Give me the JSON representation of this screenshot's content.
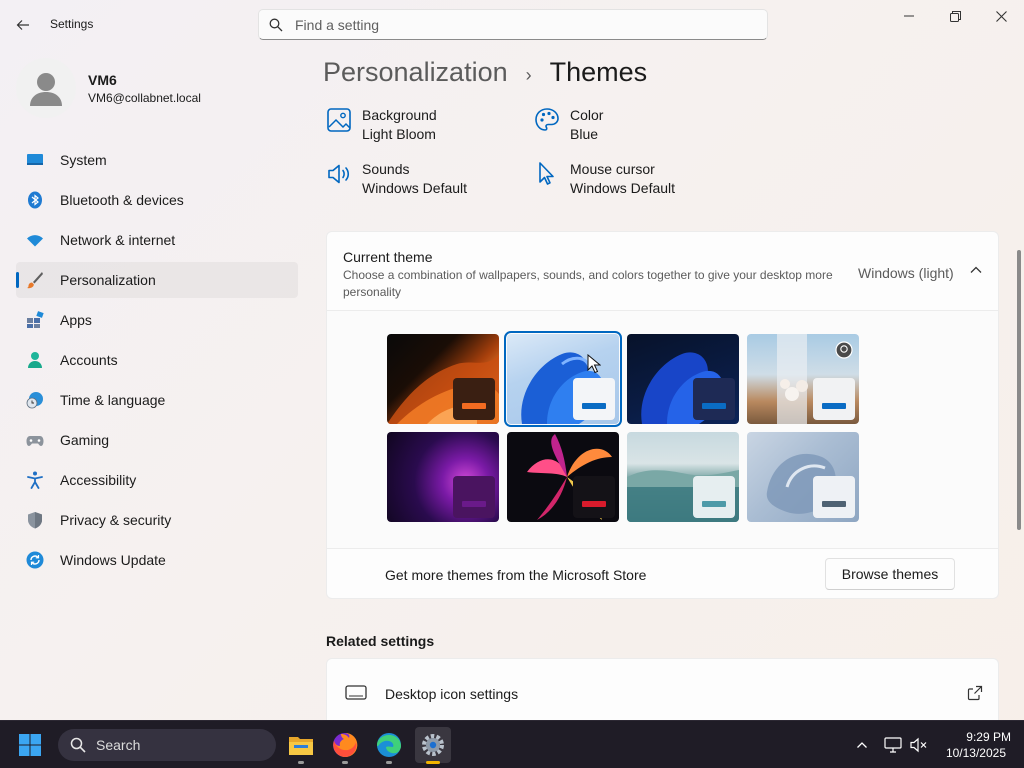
{
  "window": {
    "title": "Settings",
    "search_placeholder": "Find a setting"
  },
  "profile": {
    "name": "VM6",
    "email": "VM6@collabnet.local"
  },
  "nav": [
    {
      "label": "System",
      "icon": "system-icon"
    },
    {
      "label": "Bluetooth & devices",
      "icon": "bluetooth-icon"
    },
    {
      "label": "Network & internet",
      "icon": "wifi-icon"
    },
    {
      "label": "Personalization",
      "icon": "brush-icon",
      "selected": true
    },
    {
      "label": "Apps",
      "icon": "apps-icon"
    },
    {
      "label": "Accounts",
      "icon": "accounts-icon"
    },
    {
      "label": "Time & language",
      "icon": "globe-clock-icon"
    },
    {
      "label": "Gaming",
      "icon": "gamepad-icon"
    },
    {
      "label": "Accessibility",
      "icon": "accessibility-icon"
    },
    {
      "label": "Privacy & security",
      "icon": "shield-icon"
    },
    {
      "label": "Windows Update",
      "icon": "update-icon"
    }
  ],
  "breadcrumb": {
    "parent": "Personalization",
    "separator": "›",
    "current": "Themes"
  },
  "quick_settings": {
    "background": {
      "title": "Background",
      "value": "Light Bloom"
    },
    "color": {
      "title": "Color",
      "value": "Blue"
    },
    "sounds": {
      "title": "Sounds",
      "value": "Windows Default"
    },
    "mouse_cursor": {
      "title": "Mouse cursor",
      "value": "Windows Default"
    }
  },
  "current_theme": {
    "title": "Current theme",
    "description": "Choose a combination of wallpapers, sounds, and colors together to give your desktop more personality",
    "value": "Windows (light)",
    "expanded": true,
    "themes": [
      {
        "name": "orange-dark",
        "accent": "#f26b21",
        "selected": false
      },
      {
        "name": "windows-light",
        "accent": "#0a6cc4",
        "selected": true
      },
      {
        "name": "windows-dark",
        "accent": "#0a6cc4",
        "selected": false
      },
      {
        "name": "spotlight",
        "accent": "#0a6cc4",
        "selected": false
      },
      {
        "name": "glow",
        "accent": "#6a1a8a",
        "selected": false
      },
      {
        "name": "captured-motion",
        "accent": "#d81b2c",
        "selected": false
      },
      {
        "name": "sunrise",
        "accent": "#4e9aa8",
        "selected": false
      },
      {
        "name": "flow",
        "accent": "#4f6273",
        "selected": false
      }
    ],
    "store_text": "Get more themes from the Microsoft Store",
    "browse_button": "Browse themes"
  },
  "related": {
    "title": "Related settings",
    "items": [
      {
        "label": "Desktop icon settings",
        "icon": "monitor-icon"
      }
    ]
  },
  "taskbar": {
    "search_label": "Search",
    "apps": [
      "file-explorer-icon",
      "firefox-icon",
      "edge-icon",
      "settings-gear-icon"
    ],
    "time": "9:29 PM",
    "date": "10/13/2025"
  },
  "colors": {
    "accent": "#0067c0",
    "taskbar": "#1f1c26"
  }
}
